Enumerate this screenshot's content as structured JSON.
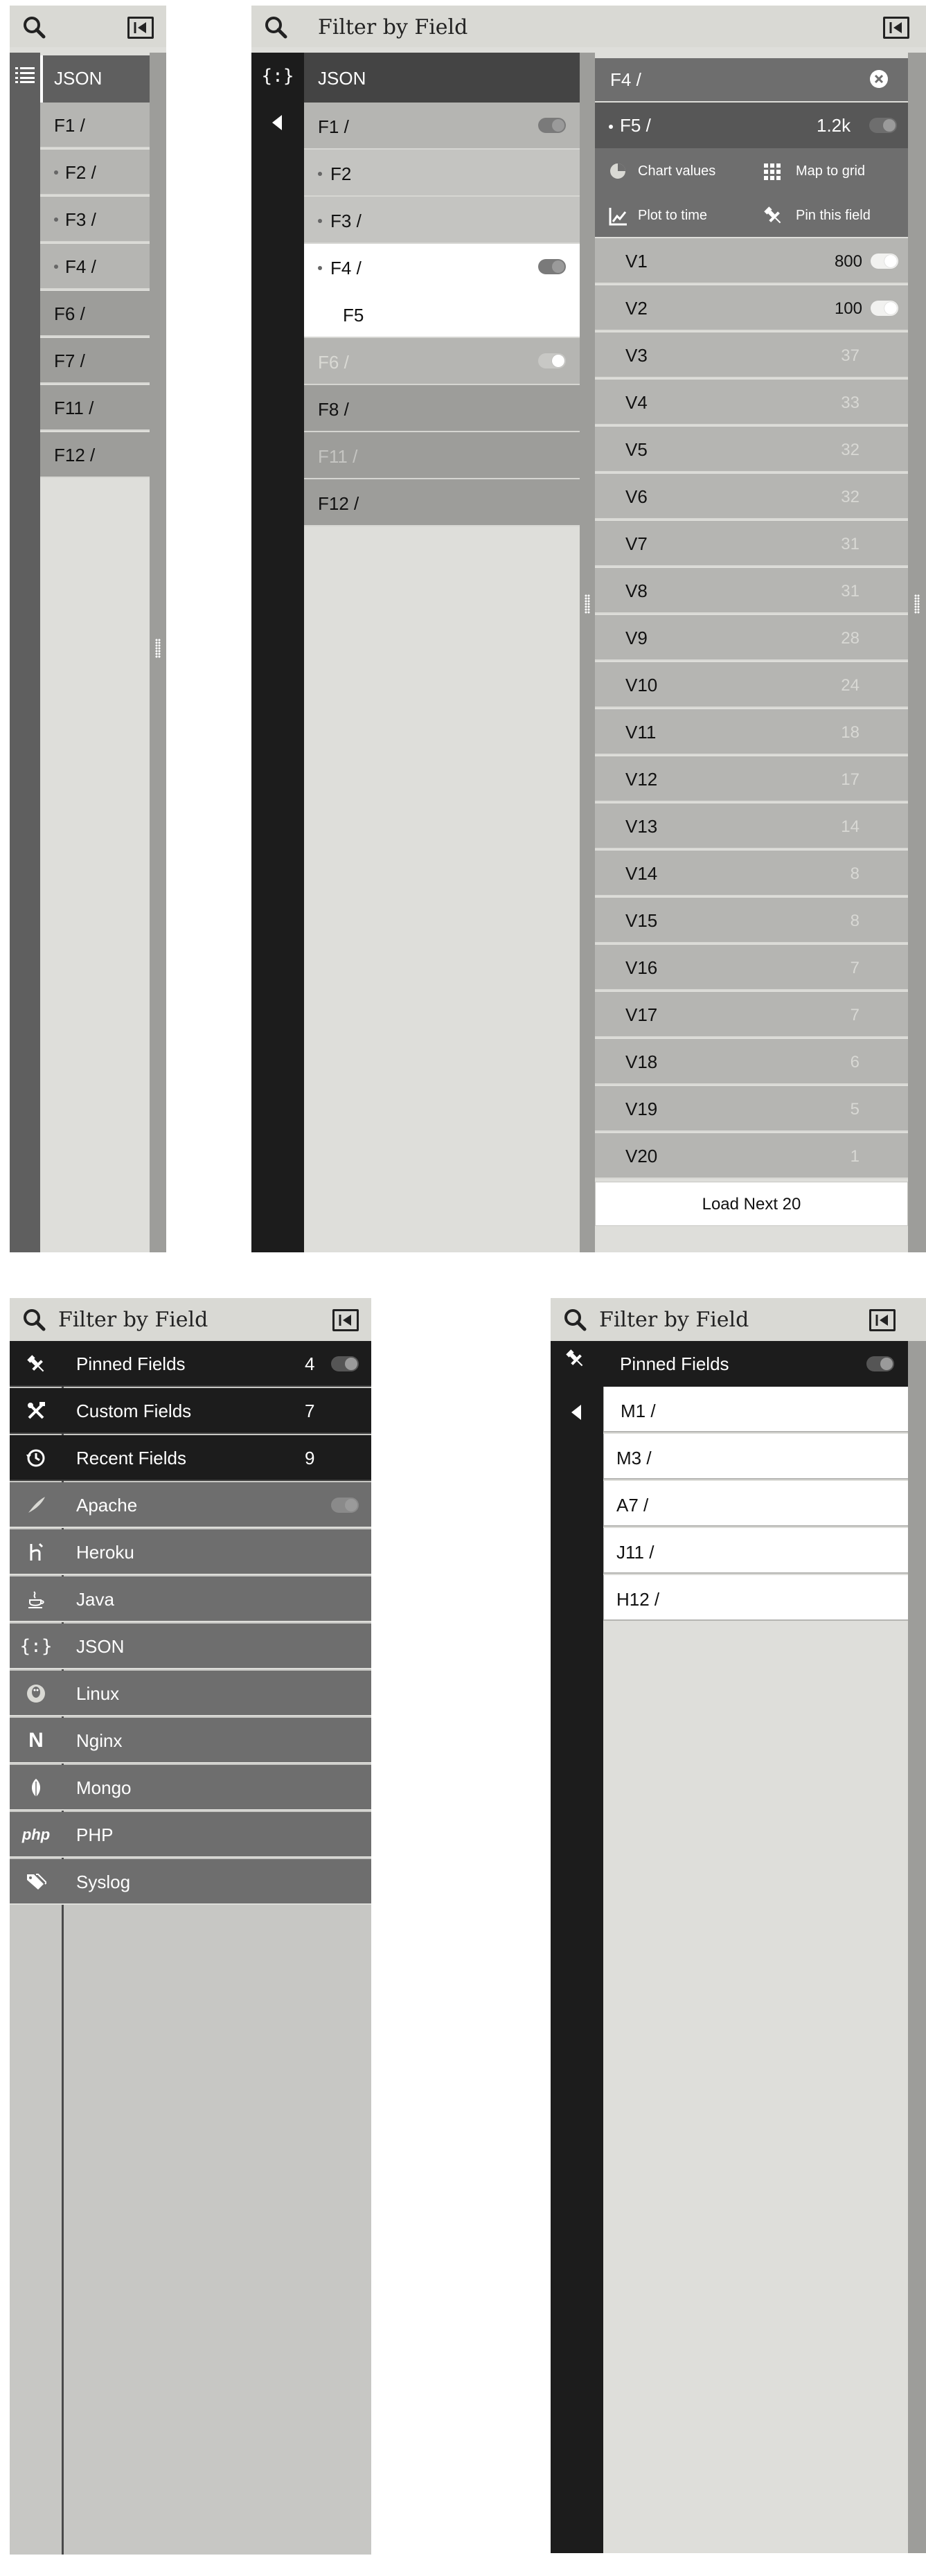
{
  "panel_a": {
    "json_label": "JSON",
    "items": [
      {
        "label": "F1 /",
        "dot": false
      },
      {
        "label": "F2 /",
        "dot": true
      },
      {
        "label": "F3 /",
        "dot": true
      },
      {
        "label": "F4 /",
        "dot": true
      },
      {
        "label": "F6 /",
        "dot": false
      },
      {
        "label": "F7 /",
        "dot": false
      },
      {
        "label": "F11 /",
        "dot": false
      },
      {
        "label": "F12 /",
        "dot": false
      }
    ]
  },
  "panel_b": {
    "title": "Filter by Field",
    "json_icon": "{:}",
    "json_label": "JSON",
    "items": [
      {
        "label": "F1 /",
        "dot": false,
        "toggle": true
      },
      {
        "label": "F2",
        "dot": true,
        "toggle": false
      },
      {
        "label": "F3 /",
        "dot": true,
        "toggle": false
      },
      {
        "label": "F4 /",
        "dot": true,
        "toggle": true
      },
      {
        "label": "F5",
        "dot": false,
        "toggle": false
      },
      {
        "label": "F6 /",
        "dot": false,
        "toggle": true
      },
      {
        "label": "F8 /",
        "dot": false,
        "toggle": false
      },
      {
        "label": "F11 /",
        "dot": false,
        "toggle": false
      },
      {
        "label": "F12 /",
        "dot": false,
        "toggle": false
      }
    ],
    "detail": {
      "path": "F4 /",
      "field": "F5 /",
      "field_count": "1.2k",
      "actions": {
        "chart": "Chart values",
        "map": "Map to grid",
        "plot": "Plot to time",
        "pin": "Pin this field"
      },
      "values": [
        {
          "label": "V1",
          "count": "800"
        },
        {
          "label": "V2",
          "count": "100"
        },
        {
          "label": "V3",
          "count": "37"
        },
        {
          "label": "V4",
          "count": "33"
        },
        {
          "label": "V5",
          "count": "32"
        },
        {
          "label": "V6",
          "count": "32"
        },
        {
          "label": "V7",
          "count": "31"
        },
        {
          "label": "V8",
          "count": "31"
        },
        {
          "label": "V9",
          "count": "28"
        },
        {
          "label": "V10",
          "count": "24"
        },
        {
          "label": "V11",
          "count": "18"
        },
        {
          "label": "V12",
          "count": "17"
        },
        {
          "label": "V13",
          "count": "14"
        },
        {
          "label": "V14",
          "count": "8"
        },
        {
          "label": "V15",
          "count": "8"
        },
        {
          "label": "V16",
          "count": "7"
        },
        {
          "label": "V17",
          "count": "7"
        },
        {
          "label": "V18",
          "count": "6"
        },
        {
          "label": "V19",
          "count": "5"
        },
        {
          "label": "V20",
          "count": "1"
        }
      ],
      "load_next": "Load Next 20"
    }
  },
  "panel_c": {
    "title": "Filter by Field",
    "categories": [
      {
        "label": "Pinned Fields",
        "count": "4",
        "icon": "pin-icon"
      },
      {
        "label": "Custom Fields",
        "count": "7",
        "icon": "tools-icon"
      },
      {
        "label": "Recent Fields",
        "count": "9",
        "icon": "history-icon"
      },
      {
        "label": "Apache",
        "count": "",
        "icon": "feather-icon"
      },
      {
        "label": "Heroku",
        "count": "",
        "icon": "heroku-icon"
      },
      {
        "label": "Java",
        "count": "",
        "icon": "java-icon"
      },
      {
        "label": "JSON",
        "count": "",
        "icon": "json-icon",
        "glyph": "{:}"
      },
      {
        "label": "Linux",
        "count": "",
        "icon": "linux-icon"
      },
      {
        "label": "Nginx",
        "count": "",
        "icon": "nginx-icon",
        "glyph": "N"
      },
      {
        "label": "Mongo",
        "count": "",
        "icon": "leaf-icon"
      },
      {
        "label": "PHP",
        "count": "",
        "icon": "php-icon",
        "glyph": "php"
      },
      {
        "label": "Syslog",
        "count": "",
        "icon": "tags-icon"
      }
    ]
  },
  "panel_d": {
    "title": "Filter by Field",
    "header_label": "Pinned Fields",
    "items": [
      "M1 /",
      "M3 /",
      "A7 /",
      "J11 /",
      "H12 /"
    ]
  },
  "colors": {
    "header_bg": "#d9d9d4",
    "dark_rail": "#1c1c1c",
    "mid_gray": "#6e6e6e",
    "row_gray": "#b5b5b2",
    "canvas": "#dededa"
  }
}
